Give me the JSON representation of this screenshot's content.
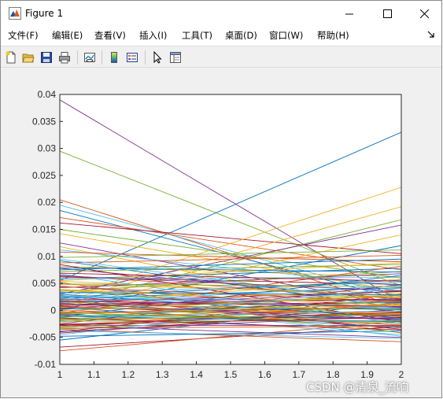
{
  "window": {
    "title": "Figure 1",
    "icon": "matlab-icon"
  },
  "menu": [
    {
      "label": "文件(F)"
    },
    {
      "label": "编辑(E)"
    },
    {
      "label": "查看(V)"
    },
    {
      "label": "插入(I)"
    },
    {
      "label": "工具(T)"
    },
    {
      "label": "桌面(D)"
    },
    {
      "label": "窗口(W)"
    },
    {
      "label": "帮助(H)"
    }
  ],
  "toolbar": [
    {
      "name": "new-figure-icon"
    },
    {
      "name": "open-file-icon"
    },
    {
      "name": "save-icon"
    },
    {
      "name": "print-icon"
    },
    {
      "name": "link-plot-icon"
    },
    {
      "name": "colorbar-icon"
    },
    {
      "name": "legend-icon"
    },
    {
      "name": "edit-plot-pointer-icon"
    },
    {
      "name": "property-inspector-icon"
    }
  ],
  "watermark": "CSDN @清泉_流响",
  "chart_data": {
    "type": "line",
    "title": "",
    "xlabel": "",
    "ylabel": "",
    "xlim": [
      1,
      2
    ],
    "ylim": [
      -0.01,
      0.04
    ],
    "xticks": [
      "1",
      "1.1",
      "1.2",
      "1.3",
      "1.4",
      "1.5",
      "1.6",
      "1.7",
      "1.8",
      "1.9",
      "2"
    ],
    "yticks": [
      "-0.01",
      "-0.005",
      "0",
      "0.005",
      "0.01",
      "0.015",
      "0.02",
      "0.025",
      "0.03",
      "0.035",
      "0.04"
    ],
    "grid": false,
    "legend": "none",
    "x": [
      1,
      2
    ],
    "series": [
      {
        "values": [
          0.039,
          0.0015
        ],
        "color": "#7E2F8E"
      },
      {
        "values": [
          0.0295,
          0.0045
        ],
        "color": "#77AC30"
      },
      {
        "values": [
          0.0055,
          0.033
        ],
        "color": "#0072BD"
      },
      {
        "values": [
          0.0205,
          0.0005
        ],
        "color": "#D95319"
      },
      {
        "values": [
          0.0195,
          0.0025
        ],
        "color": "#4DBEEE"
      },
      {
        "values": [
          0.0185,
          0.002
        ],
        "color": "#0072BD"
      },
      {
        "values": [
          0.0172,
          0.0075
        ],
        "color": "#D95319"
      },
      {
        "values": [
          0.0162,
          0.0105
        ],
        "color": "#A2142F"
      },
      {
        "values": [
          0.015,
          0.006
        ],
        "color": "#77AC30"
      },
      {
        "values": [
          0.0142,
          0.0035
        ],
        "color": "#EDB120"
      },
      {
        "values": [
          0.002,
          0.0228
        ],
        "color": "#EDB120"
      },
      {
        "values": [
          0.0015,
          0.0192
        ],
        "color": "#EDB120"
      },
      {
        "values": [
          0.001,
          0.0168
        ],
        "color": "#77AC30"
      },
      {
        "values": [
          0.003,
          0.0158
        ],
        "color": "#7E2F8E"
      },
      {
        "values": [
          0.0005,
          0.014
        ],
        "color": "#EDB120"
      },
      {
        "values": [
          0.0125,
          0.001
        ],
        "color": "#7E2F8E"
      },
      {
        "values": [
          0.0118,
          -0.0005
        ],
        "color": "#EDB120"
      },
      {
        "values": [
          0.0112,
          0.0045
        ],
        "color": "#4DBEEE"
      },
      {
        "values": [
          0.0108,
          0.009
        ],
        "color": "#D95319"
      },
      {
        "values": [
          0.0002,
          0.012
        ],
        "color": "#0072BD"
      },
      {
        "values": [
          -0.004,
          0.003
        ],
        "color": "#A2142F"
      },
      {
        "values": [
          -0.0055,
          0.0015
        ],
        "color": "#0072BD"
      },
      {
        "values": [
          -0.0068,
          -0.003
        ],
        "color": "#A2142F"
      },
      {
        "values": [
          -0.0075,
          -0.002
        ],
        "color": "#D95319"
      },
      {
        "values": [
          -0.0035,
          -0.0058
        ],
        "color": "#D95319"
      },
      {
        "values": [
          -0.0028,
          -0.005
        ],
        "color": "#7E2F8E"
      },
      {
        "values": [
          0.0098,
          0.0112
        ],
        "color": "#77AC30"
      },
      {
        "values": [
          0.0092,
          0.0005
        ],
        "color": "#0072BD"
      },
      {
        "values": [
          0.0088,
          0.0102
        ],
        "color": "#D95319"
      },
      {
        "values": [
          0.0082,
          0.0062
        ],
        "color": "#EDB120"
      },
      {
        "values": [
          0.0078,
          0.002
        ],
        "color": "#7E2F8E"
      },
      {
        "values": [
          0.0072,
          0.0085
        ],
        "color": "#77AC30"
      },
      {
        "values": [
          0.0068,
          -0.0025
        ],
        "color": "#4DBEEE"
      },
      {
        "values": [
          0.0062,
          0.0048
        ],
        "color": "#A2142F"
      },
      {
        "values": [
          0.0058,
          0.0078
        ],
        "color": "#0072BD"
      },
      {
        "values": [
          0.0052,
          -0.0042
        ],
        "color": "#D95319"
      },
      {
        "values": [
          0.0048,
          0.0032
        ],
        "color": "#EDB120"
      },
      {
        "values": [
          0.0042,
          0.0068
        ],
        "color": "#7E2F8E"
      },
      {
        "values": [
          0.0038,
          -0.0012
        ],
        "color": "#77AC30"
      },
      {
        "values": [
          0.0032,
          0.0052
        ],
        "color": "#4DBEEE"
      },
      {
        "values": [
          0.0028,
          -0.0035
        ],
        "color": "#A2142F"
      },
      {
        "values": [
          0.0022,
          0.0042
        ],
        "color": "#0072BD"
      },
      {
        "values": [
          0.0018,
          0.0008
        ],
        "color": "#D95319"
      },
      {
        "values": [
          0.0012,
          0.0058
        ],
        "color": "#EDB120"
      },
      {
        "values": [
          0.0008,
          -0.0018
        ],
        "color": "#7E2F8E"
      },
      {
        "values": [
          0.0002,
          0.0028
        ],
        "color": "#77AC30"
      },
      {
        "values": [
          -0.0002,
          -0.0045
        ],
        "color": "#4DBEEE"
      },
      {
        "values": [
          -0.0008,
          0.0018
        ],
        "color": "#A2142F"
      },
      {
        "values": [
          -0.0012,
          0.0065
        ],
        "color": "#0072BD"
      },
      {
        "values": [
          -0.0018,
          -0.0008
        ],
        "color": "#D95319"
      },
      {
        "values": [
          -0.0022,
          0.0038
        ],
        "color": "#EDB120"
      },
      {
        "values": [
          -0.0028,
          -0.0028
        ],
        "color": "#7E2F8E"
      },
      {
        "values": [
          -0.0032,
          0.0012
        ],
        "color": "#77AC30"
      },
      {
        "values": [
          -0.0038,
          -0.0052
        ],
        "color": "#4DBEEE"
      },
      {
        "values": [
          -0.0042,
          0.0002
        ],
        "color": "#A2142F"
      },
      {
        "values": [
          -0.0048,
          -0.0038
        ],
        "color": "#0072BD"
      },
      {
        "values": [
          0.0095,
          0.0012
        ],
        "color": "#4DBEEE"
      },
      {
        "values": [
          0.0085,
          -0.0022
        ],
        "color": "#A2142F"
      },
      {
        "values": [
          0.0075,
          0.0095
        ],
        "color": "#0072BD"
      },
      {
        "values": [
          0.0065,
          0.0022
        ],
        "color": "#D95319"
      },
      {
        "values": [
          0.0055,
          0.0088
        ],
        "color": "#EDB120"
      },
      {
        "values": [
          0.0045,
          -0.0002
        ],
        "color": "#7E2F8E"
      },
      {
        "values": [
          0.0035,
          0.0072
        ],
        "color": "#77AC30"
      },
      {
        "values": [
          0.0025,
          -0.0048
        ],
        "color": "#4DBEEE"
      },
      {
        "values": [
          0.0015,
          0.0035
        ],
        "color": "#A2142F"
      },
      {
        "values": [
          0.0005,
          -0.0032
        ],
        "color": "#0072BD"
      },
      {
        "values": [
          -0.0005,
          0.0082
        ],
        "color": "#D95319"
      },
      {
        "values": [
          -0.0015,
          -0.0015
        ],
        "color": "#EDB120"
      },
      {
        "values": [
          -0.0025,
          0.0048
        ],
        "color": "#7E2F8E"
      },
      {
        "values": [
          -0.0035,
          -0.0005
        ],
        "color": "#77AC30"
      },
      {
        "values": [
          -0.0045,
          0.0025
        ],
        "color": "#4DBEEE"
      },
      {
        "values": [
          0.0003,
          0.0003
        ],
        "color": "#0072BD"
      },
      {
        "values": [
          -0.0003,
          -0.0003
        ],
        "color": "#D95319"
      },
      {
        "values": [
          0.0006,
          -0.0006
        ],
        "color": "#EDB120"
      },
      {
        "values": [
          -0.0006,
          0.0006
        ],
        "color": "#7E2F8E"
      },
      {
        "values": [
          0.0012,
          0.0001
        ],
        "color": "#77AC30"
      },
      {
        "values": [
          -0.0012,
          -0.0001
        ],
        "color": "#4DBEEE"
      },
      {
        "values": [
          0.0009,
          0.0015
        ],
        "color": "#A2142F"
      },
      {
        "values": [
          -0.0009,
          -0.0015
        ],
        "color": "#0072BD"
      },
      {
        "values": [
          0.0016,
          -0.0009
        ],
        "color": "#D95319"
      },
      {
        "values": [
          -0.0016,
          0.0009
        ],
        "color": "#EDB120"
      },
      {
        "values": [
          0.002,
          0.0019
        ],
        "color": "#7E2F8E"
      },
      {
        "values": [
          -0.002,
          -0.0019
        ],
        "color": "#77AC30"
      },
      {
        "values": [
          0.0026,
          0.0004
        ],
        "color": "#4DBEEE"
      },
      {
        "values": [
          -0.0026,
          -0.0004
        ],
        "color": "#A2142F"
      },
      {
        "values": [
          0.003,
          -0.0014
        ],
        "color": "#0072BD"
      },
      {
        "values": [
          -0.003,
          0.0014
        ],
        "color": "#D95319"
      },
      {
        "values": [
          0.0036,
          0.0024
        ],
        "color": "#EDB120"
      },
      {
        "values": [
          0.0004,
          0.0036
        ],
        "color": "#7E2F8E"
      },
      {
        "values": [
          -0.0004,
          -0.0024
        ],
        "color": "#77AC30"
      },
      {
        "values": [
          0.0014,
          0.0046
        ],
        "color": "#4DBEEE"
      },
      {
        "values": [
          -0.0014,
          -0.0036
        ],
        "color": "#A2142F"
      },
      {
        "values": [
          0.0024,
          0.0056
        ],
        "color": "#0072BD"
      },
      {
        "values": [
          0.0044,
          0.0016
        ],
        "color": "#D95319"
      },
      {
        "values": [
          0.0054,
          0.0026
        ],
        "color": "#EDB120"
      },
      {
        "values": [
          0.0064,
          0.0036
        ],
        "color": "#7E2F8E"
      },
      {
        "values": [
          0.0019,
          -0.0041
        ],
        "color": "#77AC30"
      },
      {
        "values": [
          -0.0019,
          0.0041
        ],
        "color": "#4DBEEE"
      },
      {
        "values": [
          0.0011,
          0.0021
        ],
        "color": "#A2142F"
      },
      {
        "values": [
          -0.0011,
          -0.0021
        ],
        "color": "#0072BD"
      },
      {
        "values": [
          0.0007,
          -0.0011
        ],
        "color": "#D95319"
      },
      {
        "values": [
          -0.0007,
          0.0011
        ],
        "color": "#EDB120"
      },
      {
        "values": [
          0.0017,
          0.0007
        ],
        "color": "#7E2F8E"
      },
      {
        "values": [
          -0.0017,
          -0.0007
        ],
        "color": "#77AC30"
      },
      {
        "values": [
          0.0027,
          0.0013
        ],
        "color": "#4DBEEE"
      },
      {
        "values": [
          -0.0027,
          -0.0013
        ],
        "color": "#A2142F"
      },
      {
        "values": [
          0.0033,
          0.0029
        ],
        "color": "#0072BD"
      },
      {
        "values": [
          -0.0033,
          -0.0029
        ],
        "color": "#D95319"
      },
      {
        "values": [
          0.0039,
          0.0009
        ],
        "color": "#EDB120"
      },
      {
        "values": [
          -0.0039,
          -0.0009
        ],
        "color": "#7E2F8E"
      },
      {
        "values": [
          0.0049,
          0.0044
        ],
        "color": "#77AC30"
      },
      {
        "values": [
          0.0059,
          0.0061
        ],
        "color": "#4DBEEE"
      },
      {
        "values": [
          0.0069,
          0.0054
        ],
        "color": "#A2142F"
      },
      {
        "values": [
          0.0079,
          0.0071
        ],
        "color": "#0072BD"
      },
      {
        "values": [
          0.0001,
          -0.0027
        ],
        "color": "#D95319"
      },
      {
        "values": [
          -0.0001,
          0.0027
        ],
        "color": "#EDB120"
      },
      {
        "values": [
          0.0013,
          -0.0017
        ],
        "color": "#7E2F8E"
      },
      {
        "values": [
          -0.0013,
          0.0017
        ],
        "color": "#77AC30"
      }
    ]
  }
}
